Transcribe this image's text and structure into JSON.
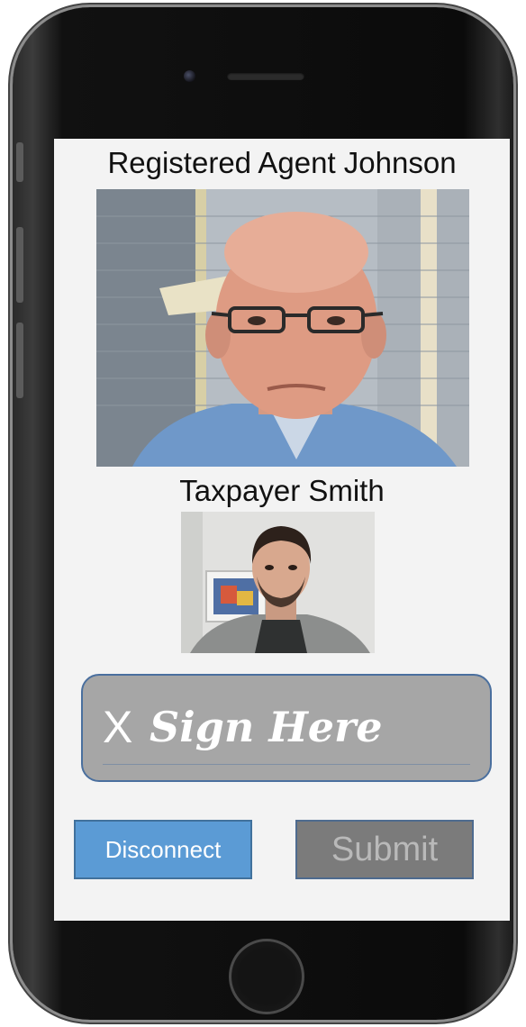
{
  "call": {
    "agent_label": "Registered Agent Johnson",
    "taxpayer_label": "Taxpayer Smith"
  },
  "signature": {
    "x_mark": "X",
    "prompt": "Sign Here"
  },
  "actions": {
    "disconnect_label": "Disconnect",
    "submit_label": "Submit"
  },
  "colors": {
    "disconnect_bg": "#5b9bd5",
    "submit_bg": "#7b7b7b",
    "signature_bg": "#a6a6a6",
    "screen_bg": "#f3f3f3"
  },
  "icons": {
    "camera": "front-camera-icon",
    "speaker": "speaker-grille-icon",
    "home": "home-button-icon"
  }
}
